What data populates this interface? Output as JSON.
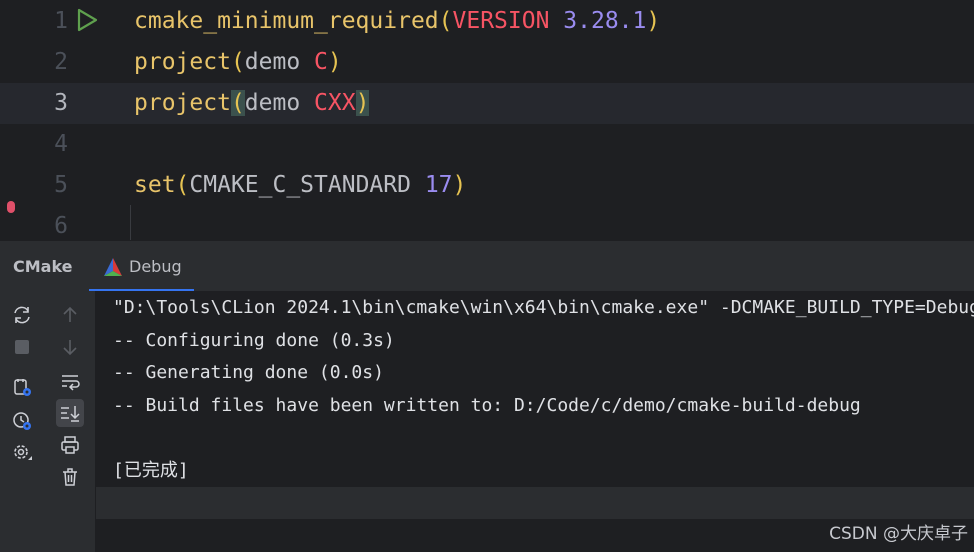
{
  "editor": {
    "lines": [
      {
        "number": "1",
        "tokens": [
          {
            "text": "cmake_minimum_required",
            "kind": "fn"
          },
          {
            "text": "(",
            "kind": "paren"
          },
          {
            "text": "VERSION",
            "kind": "kw"
          },
          {
            "text": " ",
            "kind": "id"
          },
          {
            "text": "3.28.1",
            "kind": "num"
          },
          {
            "text": ")",
            "kind": "paren"
          }
        ]
      },
      {
        "number": "2",
        "tokens": [
          {
            "text": "project",
            "kind": "fn"
          },
          {
            "text": "(",
            "kind": "paren"
          },
          {
            "text": "demo ",
            "kind": "id"
          },
          {
            "text": "C",
            "kind": "kw"
          },
          {
            "text": ")",
            "kind": "paren"
          }
        ]
      },
      {
        "number": "3",
        "tokens": [
          {
            "text": "project",
            "kind": "fn"
          },
          {
            "text": "(",
            "kind": "paren",
            "match": true
          },
          {
            "text": "demo ",
            "kind": "id"
          },
          {
            "text": "CXX",
            "kind": "kw"
          },
          {
            "text": ")",
            "kind": "paren",
            "match": true
          }
        ]
      },
      {
        "number": "4",
        "tokens": []
      },
      {
        "number": "5",
        "tokens": [
          {
            "text": "set",
            "kind": "fn"
          },
          {
            "text": "(",
            "kind": "paren"
          },
          {
            "text": "CMAKE_C_STANDARD ",
            "kind": "id"
          },
          {
            "text": "17",
            "kind": "num"
          },
          {
            "text": ")",
            "kind": "paren"
          }
        ]
      },
      {
        "number": "6",
        "tokens": []
      }
    ],
    "current_line": "3"
  },
  "tool_window": {
    "title": "CMake",
    "active_tab": "Debug",
    "toolbar_icons": [
      "reload-icon",
      "stop-icon",
      "cmake-settings-icon",
      "cache-icon",
      "settings-icon",
      "scroll-up-icon",
      "scroll-down-icon",
      "soft-wrap-icon",
      "scroll-to-end-icon",
      "print-icon",
      "clear-icon"
    ]
  },
  "console": {
    "lines": [
      "\"D:\\Tools\\CLion 2024.1\\bin\\cmake\\win\\x64\\bin\\cmake.exe\" -DCMAKE_BUILD_TYPE=Debug",
      "-- Configuring done (0.3s)",
      "-- Generating done (0.0s)",
      "-- Build files have been written to: D:/Code/c/demo/cmake-build-debug",
      "",
      "[已完成]"
    ]
  },
  "watermark": "CSDN @大庆卓子",
  "colors": {
    "background": "#1e1f22",
    "panel": "#2b2d30",
    "function": "#e8c46a",
    "keyword": "#f75464",
    "number": "#9a8cf0",
    "identifier": "#bcbec4",
    "accent": "#3574f0",
    "run": "#5fa04e"
  }
}
